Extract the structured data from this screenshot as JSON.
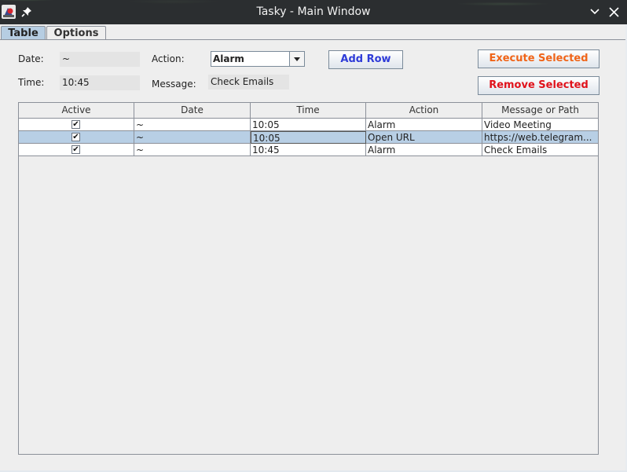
{
  "window": {
    "title": "Tasky - Main Window"
  },
  "tabs": [
    {
      "label": "Table",
      "selected": true
    },
    {
      "label": "Options",
      "selected": false
    }
  ],
  "form": {
    "date_label": "Date:",
    "date_value": "~",
    "time_label": "Time:",
    "time_value": "10:45",
    "action_label": "Action:",
    "action_value": "Alarm",
    "message_label": "Message:",
    "message_value": "Check Emails"
  },
  "buttons": {
    "add_row": "Add Row",
    "execute_selected": "Execute Selected",
    "remove_selected": "Remove Selected"
  },
  "table": {
    "columns": [
      "Active",
      "Date",
      "Time",
      "Action",
      "Message or Path"
    ],
    "rows": [
      {
        "active": true,
        "date": "~",
        "time": "10:05",
        "action": "Alarm",
        "message": "Video Meeting",
        "selected": false
      },
      {
        "active": true,
        "date": "~",
        "time": "10:05",
        "action": "Open URL",
        "message": "https://web.telegram...",
        "selected": true
      },
      {
        "active": true,
        "date": "~",
        "time": "10:45",
        "action": "Alarm",
        "message": "Check Emails",
        "selected": false
      }
    ]
  },
  "icons": {
    "app": "tasky-app-icon",
    "pin": "pin-icon",
    "minimize": "chevron-down-icon",
    "close": "close-icon",
    "dropdown": "dropdown-arrow-icon",
    "checkbox_mark": "✔"
  },
  "colors": {
    "execute_text": "#f06418",
    "remove_text": "#e0121b",
    "add_row_text": "#2e3bd8",
    "selection": "#b8cfe5"
  }
}
